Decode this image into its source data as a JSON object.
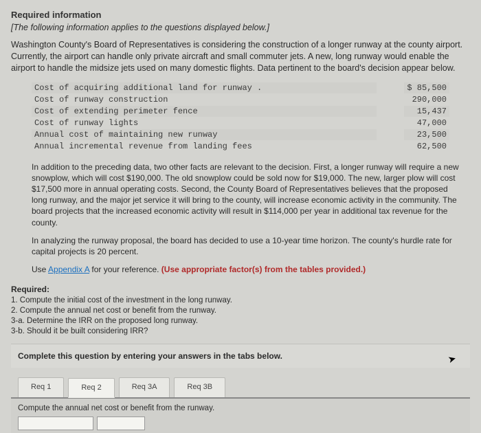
{
  "heading": "Required information",
  "intro_italic": "[The following information applies to the questions displayed below.]",
  "para1": "Washington County's Board of Representatives is considering the construction of a longer runway at the county airport. Currently, the airport can handle only private aircraft and small commuter jets. A new, long runway would enable the airport to handle the midsize jets used on many domestic flights. Data pertinent to the board's decision appear below.",
  "costs": [
    {
      "label": "Cost of acquiring additional land for runway .",
      "value": "$ 85,500"
    },
    {
      "label": "Cost of runway construction",
      "value": "290,000"
    },
    {
      "label": "Cost of extending perimeter fence",
      "value": "15,437"
    },
    {
      "label": "Cost of runway lights",
      "value": "47,000"
    },
    {
      "label": "Annual cost of maintaining new runway",
      "value": "23,500"
    },
    {
      "label": "Annual incremental revenue from landing fees",
      "value": "62,500"
    }
  ],
  "para2": "In addition to the preceding data, two other facts are relevant to the decision. First, a longer runway will require a new snowplow, which will cost $190,000. The old snowplow could be sold now for $19,000. The new, larger plow will cost $17,500 more in annual operating costs. Second, the County Board of Representatives believes that the proposed long runway, and the major jet service it will bring to the county, will increase economic activity in the community. The board projects that the increased economic activity will result in $114,000 per year in additional tax revenue for the county.",
  "para3": "In analyzing the runway proposal, the board has decided to use a 10-year time horizon. The county's hurdle rate for capital projects is 20 percent.",
  "para4_pre": "Use ",
  "para4_link": "Appendix A",
  "para4_mid": " for your reference. ",
  "para4_bold": "(Use appropriate factor(s) from the tables provided.)",
  "required": {
    "title": "Required:",
    "items": [
      "1. Compute the initial cost of the investment in the long runway.",
      "2. Compute the annual net cost or benefit from the runway.",
      "3-a. Determine the IRR on the proposed long runway.",
      "3-b. Should it be built considering IRR?"
    ]
  },
  "instruction": "Complete this question by entering your answers in the tabs below.",
  "tabs": [
    {
      "label": "Req 1"
    },
    {
      "label": "Req 2"
    },
    {
      "label": "Req 3A"
    },
    {
      "label": "Req 3B"
    }
  ],
  "tab_content_text": "Compute the annual net cost or benefit from the runway."
}
